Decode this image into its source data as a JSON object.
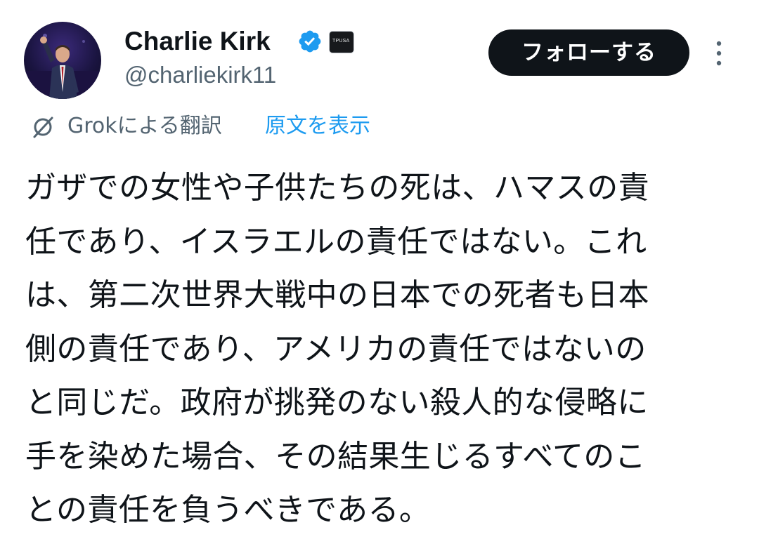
{
  "author": {
    "display_name": "Charlie Kirk",
    "handle": "@charliekirk11",
    "verified_icon": "verified-badge-icon",
    "affiliate_icon": "affiliate-badge-icon",
    "affiliate_label": "TPUSA",
    "accent_color": "#1d9bf0"
  },
  "actions": {
    "follow_label": "フォローする",
    "more_icon": "more-vertical-icon"
  },
  "translation": {
    "icon": "grok-icon",
    "translated_by": "Grokによる翻訳",
    "show_original": "原文を表示"
  },
  "tweet": {
    "lines": [
      "ガザでの女性や子供たちの死は、ハマスの責",
      "任であり、イスラエルの責任ではない。これ",
      "は、第二次世界大戦中の日本での死者も日本",
      "側の責任であり、アメリカの責任ではないの",
      "と同じだ。政府が挑発のない殺人的な侵略に",
      "手を染めた場合、その結果生じるすべてのこ",
      "との責任を負うべきである。"
    ]
  }
}
